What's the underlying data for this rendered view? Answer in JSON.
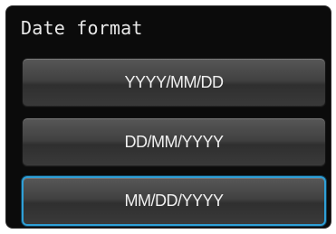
{
  "header": {
    "title": "Date format"
  },
  "options": [
    {
      "label": "YYYY/MM/DD",
      "selected": false
    },
    {
      "label": "DD/MM/YYYY",
      "selected": false
    },
    {
      "label": "MM/DD/YYYY",
      "selected": true
    }
  ],
  "colors": {
    "panel_bg": "#0b0b0b",
    "button_text": "#f0f0f0",
    "selected_outline": "#2f9fd6"
  }
}
